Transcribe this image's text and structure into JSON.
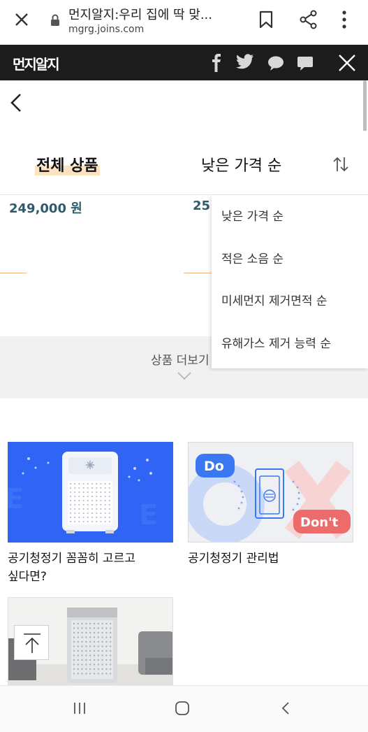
{
  "browser": {
    "title": "먼지알지:우리 집에 딱 맞...",
    "url": "mgrg.joins.com",
    "icons": [
      "close-icon",
      "lock-icon",
      "bookmark-icon",
      "share-icon",
      "more-vert-icon"
    ]
  },
  "site": {
    "logo": "먼지알지",
    "icons": [
      "facebook-icon",
      "twitter-icon",
      "kakaotalk-icon",
      "comment-icon",
      "close-icon"
    ],
    "colors": {
      "header_bg": "#1c1c1c",
      "price": "#2f5a6b",
      "accent_highlight": "#fbe3c0"
    }
  },
  "sort": {
    "all_products": "전체 상품",
    "selected": "낮은 가격 순",
    "options": [
      "낮은 가격 순",
      "적은 소음 순",
      "미세먼지 제거면적 순",
      "유해가스 제거 능력 순"
    ]
  },
  "products": {
    "price1": "249,000 원",
    "price2": "25"
  },
  "more": {
    "label": "상품 더보기"
  },
  "cards": [
    {
      "title_line1": "공기청정기 꼼꼼히 고르고",
      "title_line2": "싶다면?"
    },
    {
      "title_line1": "공기청정기 관리법",
      "title_line2": ""
    },
    {
      "do_label": "Do",
      "dont_label": "Don't"
    }
  ]
}
